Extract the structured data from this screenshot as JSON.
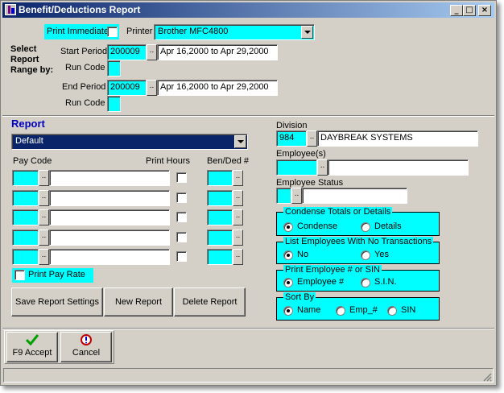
{
  "window": {
    "title": "Benefit/Deductions Report"
  },
  "top": {
    "print_immediate_label": "Print Immediate",
    "printer_label": "Printer",
    "printer_value": "Brother MFC4800",
    "select_range_label": "Select Report Range by:",
    "start_period_label": "Start Period",
    "start_period_value": "200009",
    "start_period_dates": "Apr 16,2000 to Apr 29,2000",
    "run_code_label": "Run Code",
    "end_period_label": "End Period",
    "end_period_value": "200009",
    "end_period_dates": "Apr 16,2000 to Apr 29,2000"
  },
  "report": {
    "label": "Report",
    "selected": "Default",
    "pay_code_label": "Pay Code",
    "print_hours_label": "Print Hours",
    "ben_ded_label": "Ben/Ded #",
    "rows": 5,
    "print_pay_rate_label": "Print Pay Rate"
  },
  "right": {
    "division_label": "Division",
    "division_code": "984",
    "division_name": "DAYBREAK SYSTEMS",
    "employees_label": "Employee(s)",
    "employee_status_label": "Employee Status",
    "condense": {
      "title": "Condense Totals or Details",
      "opt1": "Condense",
      "opt2": "Details"
    },
    "list_no_trans": {
      "title": "List Employees With No Transactions",
      "opt1": "No",
      "opt2": "Yes"
    },
    "print_emp": {
      "title": "Print Employee # or SIN",
      "opt1": "Employee #",
      "opt2": "S.I.N."
    },
    "sort_by": {
      "title": "Sort By",
      "opt1": "Name",
      "opt2": "Emp_#",
      "opt3": "SIN"
    }
  },
  "buttons": {
    "save_settings": "Save Report Settings",
    "new_report": "New Report",
    "delete_report": "Delete Report",
    "accept": "F9 Accept",
    "cancel": "Cancel"
  },
  "colors": {
    "title_start": "#0a246a",
    "title_end": "#a6caf0",
    "highlight": "#00ffff",
    "report_select": "#0a246a",
    "report_label": "#0000c0"
  }
}
